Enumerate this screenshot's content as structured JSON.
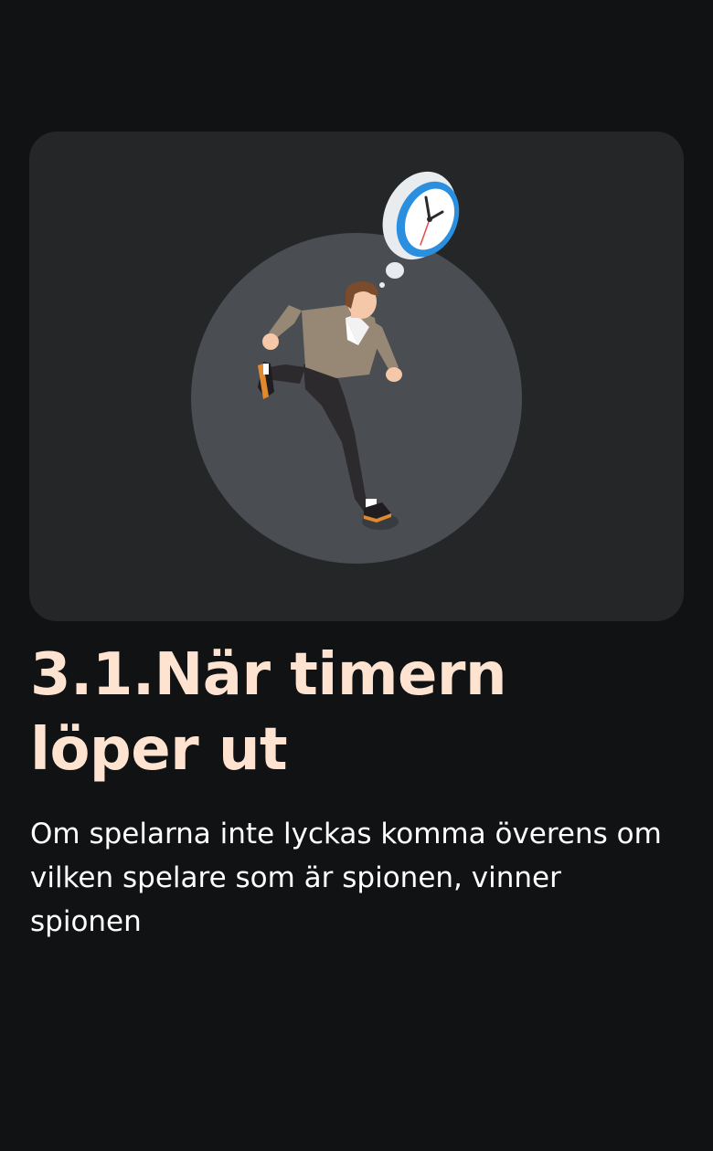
{
  "rule": {
    "title_line_1": "3.1.När timern",
    "title_line_2": "löper ut",
    "description": "Om spelarna inte lyckas komma överens om vilken spelare som är spionen, vinner spionen"
  },
  "illustration": {
    "subject": "running-man-with-clock-icon"
  },
  "colors": {
    "background": "#111214",
    "card": "#252628",
    "circle": "#4a4d51",
    "title": "#fde3d0",
    "text": "#ffffff",
    "clock_rim": "#2b8fe0"
  }
}
